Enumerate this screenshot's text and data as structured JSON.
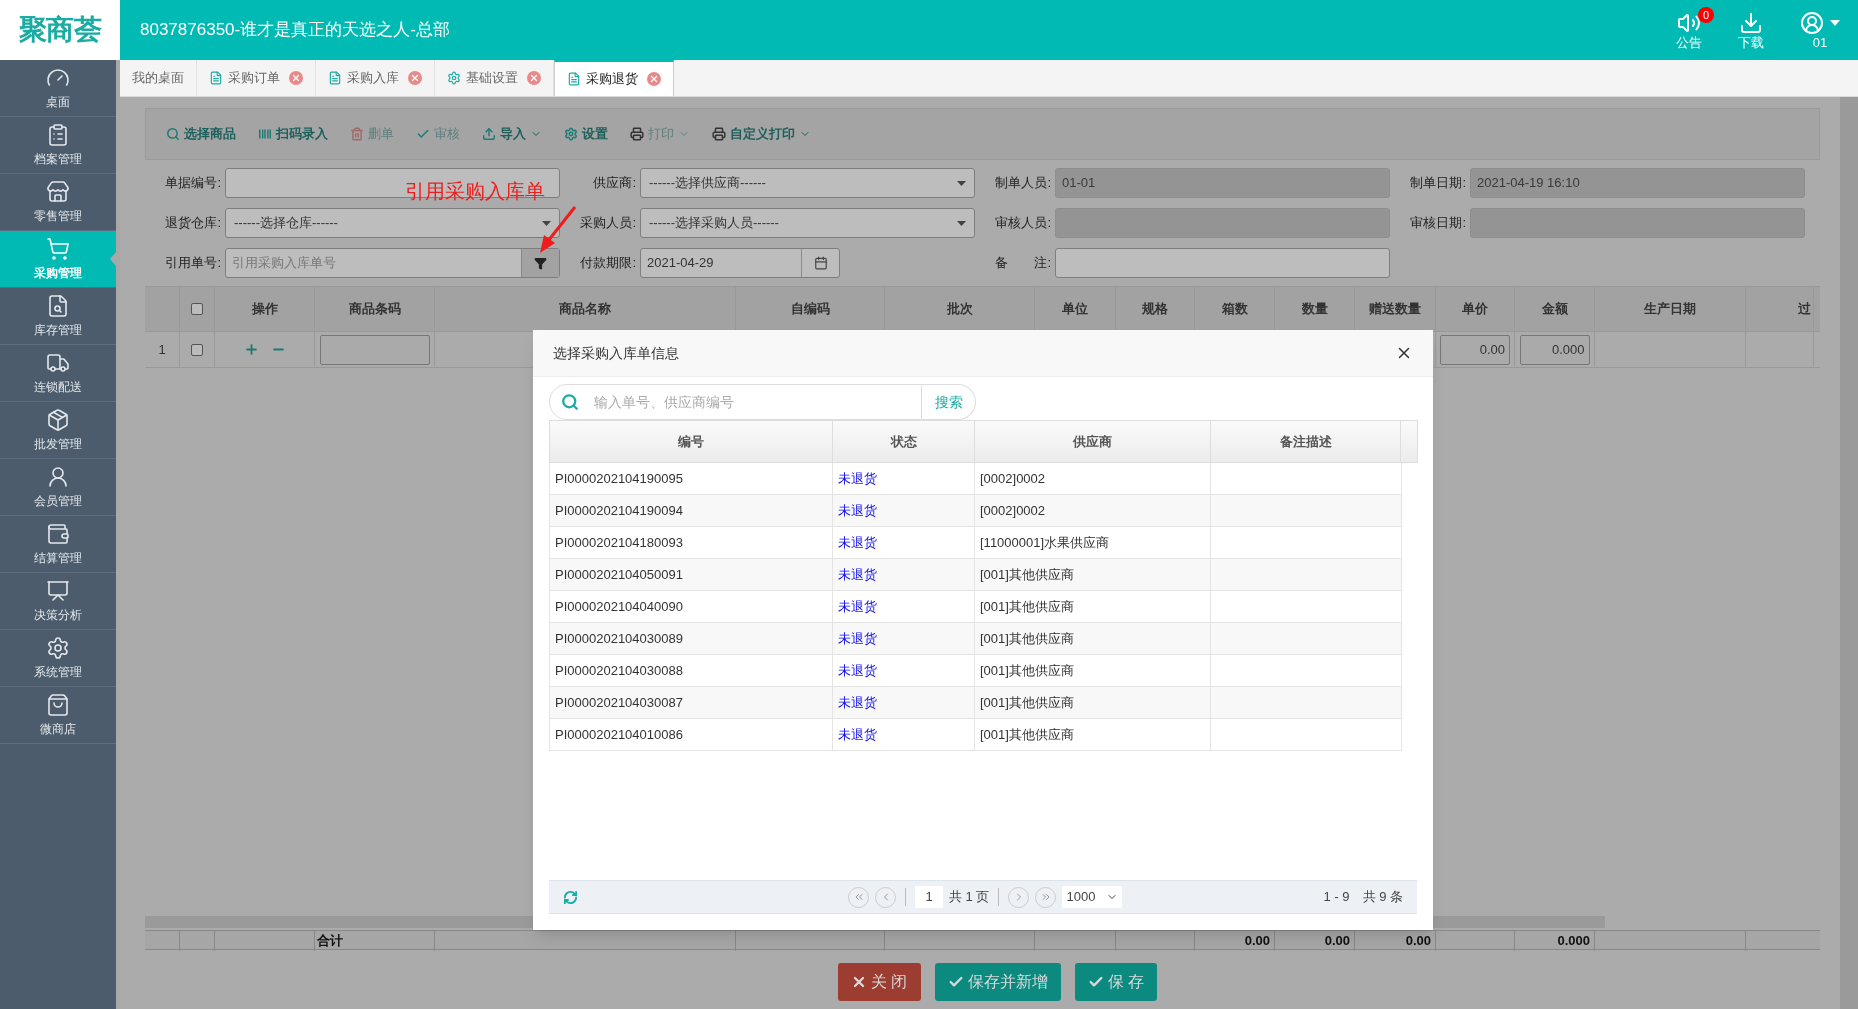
{
  "header": {
    "logo": "聚商荟",
    "title": "8037876350-谁才是真正的天选之人-总部",
    "actions": [
      {
        "kind": "notice",
        "label": "公告",
        "badge": "0"
      },
      {
        "kind": "download",
        "label": "下载"
      },
      {
        "kind": "user",
        "label": "01"
      }
    ]
  },
  "sidebar": {
    "items": [
      {
        "kind": "dashboard",
        "label": "桌面",
        "selected": false
      },
      {
        "kind": "archive",
        "label": "档案管理",
        "selected": false
      },
      {
        "kind": "store",
        "label": "零售管理",
        "selected": false
      },
      {
        "kind": "purchase",
        "label": "采购管理",
        "selected": true
      },
      {
        "kind": "stock",
        "label": "库存管理",
        "selected": false
      },
      {
        "kind": "truck",
        "label": "连锁配送",
        "selected": false
      },
      {
        "kind": "wholesale",
        "label": "批发管理",
        "selected": false
      },
      {
        "kind": "member",
        "label": "会员管理",
        "selected": false
      },
      {
        "kind": "settle",
        "label": "结算管理",
        "selected": false
      },
      {
        "kind": "analysis",
        "label": "决策分析",
        "selected": false
      },
      {
        "kind": "system",
        "label": "系统管理",
        "selected": false
      },
      {
        "kind": "shop",
        "label": "微商店",
        "selected": false
      }
    ]
  },
  "tabs": [
    {
      "kind": "plain",
      "label": "我的桌面",
      "selected": false,
      "closable": false
    },
    {
      "kind": "list",
      "label": "采购订单",
      "selected": false,
      "closable": true
    },
    {
      "kind": "list",
      "label": "采购入库",
      "selected": false,
      "closable": true
    },
    {
      "kind": "gear",
      "label": "基础设置",
      "selected": false,
      "closable": true
    },
    {
      "kind": "list",
      "label": "采购退货",
      "selected": true,
      "closable": true
    }
  ],
  "toolbar": [
    {
      "kind": "search",
      "label": "选择商品",
      "disabled": false,
      "dropdown": false
    },
    {
      "kind": "barcode",
      "label": "扫码录入",
      "disabled": false,
      "dropdown": false
    },
    {
      "kind": "delete",
      "label": "删单",
      "disabled": true,
      "dropdown": false
    },
    {
      "kind": "check",
      "label": "审核",
      "disabled": true,
      "dropdown": false
    },
    {
      "kind": "import",
      "label": "导入",
      "disabled": false,
      "dropdown": true
    },
    {
      "kind": "gear",
      "label": "设置",
      "disabled": false,
      "dropdown": false
    },
    {
      "kind": "print",
      "label": "打印",
      "disabled": true,
      "dropdown": true
    },
    {
      "kind": "print",
      "label": "自定义打印",
      "disabled": false,
      "dropdown": true
    }
  ],
  "annotation": {
    "text": "引用采购入库单"
  },
  "form": [
    {
      "label": "单据编号:",
      "kind": "text",
      "readonly": false
    },
    {
      "label": "供应商:",
      "kind": "select",
      "value": "------选择供应商------",
      "readonly": false
    },
    {
      "label": "制单人员:",
      "kind": "text",
      "value": "01-01",
      "readonly": true
    },
    {
      "label": "制单日期:",
      "kind": "text",
      "value": "2021-04-19 16:10",
      "readonly": true
    },
    {
      "label": "退货仓库:",
      "kind": "select",
      "value": "------选择仓库------",
      "readonly": false
    },
    {
      "label": "采购人员:",
      "kind": "select",
      "value": "------选择采购人员------",
      "readonly": false
    },
    {
      "label": "审核人员:",
      "kind": "text",
      "readonly": true
    },
    {
      "label": "审核日期:",
      "kind": "text",
      "readonly": true
    },
    {
      "label": "引用单号:",
      "kind": "lookup",
      "placeholder": "引用采购入库单号",
      "readonly": false
    },
    {
      "label": "付款期限:",
      "kind": "date",
      "value": "2021-04-29",
      "readonly": false
    },
    {
      "label": "备　　注:",
      "kind": "text",
      "readonly": false
    }
  ],
  "items_table": {
    "all_checked": false,
    "columns": [
      "操作",
      "商品条码",
      "商品名称",
      "自编码",
      "批次",
      "单位",
      "规格",
      "箱数",
      "数量",
      "赠送数量",
      "单价",
      "金额",
      "生产日期",
      "过"
    ],
    "rows": [
      {
        "index": "1",
        "checked": false,
        "unit_price": "0.00",
        "amount": "0.000"
      }
    ],
    "totals": {
      "label": "合计",
      "box_count": "0.00",
      "quantity": "0.00",
      "gift_quantity": "0.00",
      "amount": "0.000"
    }
  },
  "footer_buttons": [
    {
      "kind": "close",
      "label": "关 闭"
    },
    {
      "kind": "save",
      "label": "保存并新增"
    },
    {
      "kind": "save",
      "label": "保 存"
    }
  ],
  "dialog": {
    "title": "选择采购入库单信息",
    "search": {
      "placeholder": "输入单号、供应商编号",
      "button": "搜索"
    },
    "columns": [
      "编号",
      "状态",
      "供应商",
      "备注描述"
    ],
    "rows": [
      {
        "number": "PI0000202104190095",
        "status": "未退货",
        "supplier": "[0002]0002"
      },
      {
        "number": "PI0000202104190094",
        "status": "未退货",
        "supplier": "[0002]0002"
      },
      {
        "number": "PI0000202104180093",
        "status": "未退货",
        "supplier": "[11000001]水果供应商"
      },
      {
        "number": "PI0000202104050091",
        "status": "未退货",
        "supplier": "[001]其他供应商"
      },
      {
        "number": "PI0000202104040090",
        "status": "未退货",
        "supplier": "[001]其他供应商"
      },
      {
        "number": "PI0000202104030089",
        "status": "未退货",
        "supplier": "[001]其他供应商"
      },
      {
        "number": "PI0000202104030088",
        "status": "未退货",
        "supplier": "[001]其他供应商"
      },
      {
        "number": "PI0000202104030087",
        "status": "未退货",
        "supplier": "[001]其他供应商"
      },
      {
        "number": "PI0000202104010086",
        "status": "未退货",
        "supplier": "[001]其他供应商"
      }
    ],
    "pager": {
      "page": "1",
      "total_pages": "共 1 页",
      "page_size": "1000",
      "summary": "1 - 9　共 9 条"
    }
  }
}
